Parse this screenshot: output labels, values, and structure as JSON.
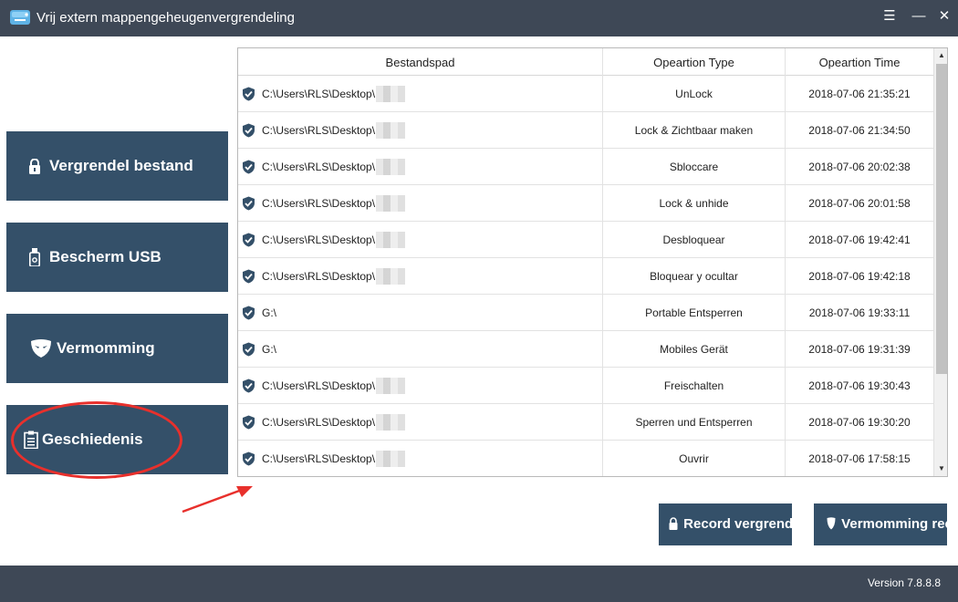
{
  "window": {
    "title": "Vrij extern mappengeheugenvergrendeling",
    "menu_icon": "☰",
    "minimize_icon": "—",
    "close_icon": "✕"
  },
  "sidebar": {
    "items": [
      {
        "label": "Vergrendel bestand",
        "icon": "lock-icon"
      },
      {
        "label": "Bescherm USB",
        "icon": "usb-icon"
      },
      {
        "label": "Vermomming",
        "icon": "mask-icon"
      },
      {
        "label": "Geschiedenis",
        "icon": "clipboard-icon"
      }
    ]
  },
  "table": {
    "headers": [
      "Bestandspad",
      "Opeartion Type",
      "Opeartion Time"
    ],
    "rows": [
      {
        "path": "C:\\Users\\RLS\\Desktop\\",
        "type": "UnLock",
        "time": "2018-07-06 21:35:21"
      },
      {
        "path": "C:\\Users\\RLS\\Desktop\\",
        "type": "Lock & Zichtbaar maken",
        "time": "2018-07-06 21:34:50"
      },
      {
        "path": "C:\\Users\\RLS\\Desktop\\",
        "type": "Sbloccare",
        "time": "2018-07-06 20:02:38"
      },
      {
        "path": "C:\\Users\\RLS\\Desktop\\",
        "type": "Lock & unhide",
        "time": "2018-07-06 20:01:58"
      },
      {
        "path": "C:\\Users\\RLS\\Desktop\\",
        "type": "Desbloquear",
        "time": "2018-07-06 19:42:41"
      },
      {
        "path": "C:\\Users\\RLS\\Desktop\\",
        "type": "Bloquear y ocultar",
        "time": "2018-07-06 19:42:18"
      },
      {
        "path": "G:\\",
        "type": "Portable Entsperren",
        "time": "2018-07-06 19:33:11"
      },
      {
        "path": "G:\\",
        "type": "Mobiles Gerät",
        "time": "2018-07-06 19:31:39"
      },
      {
        "path": "C:\\Users\\RLS\\Desktop\\",
        "type": "Freischalten",
        "time": "2018-07-06 19:30:43"
      },
      {
        "path": "C:\\Users\\RLS\\Desktop\\",
        "type": "Sperren und Entsperren",
        "time": "2018-07-06 19:30:20"
      },
      {
        "path": "C:\\Users\\RLS\\Desktop\\",
        "type": "Ouvrir",
        "time": "2018-07-06 17:58:15"
      }
    ]
  },
  "actions": {
    "record_lock_label": "Record vergrendeling",
    "record_disguise_label": "Vermomming record"
  },
  "footer": {
    "version": "Version 7.8.8.8"
  },
  "colors": {
    "titlebar": "#3e4856",
    "button": "#345069",
    "annotation": "#e8302c"
  }
}
